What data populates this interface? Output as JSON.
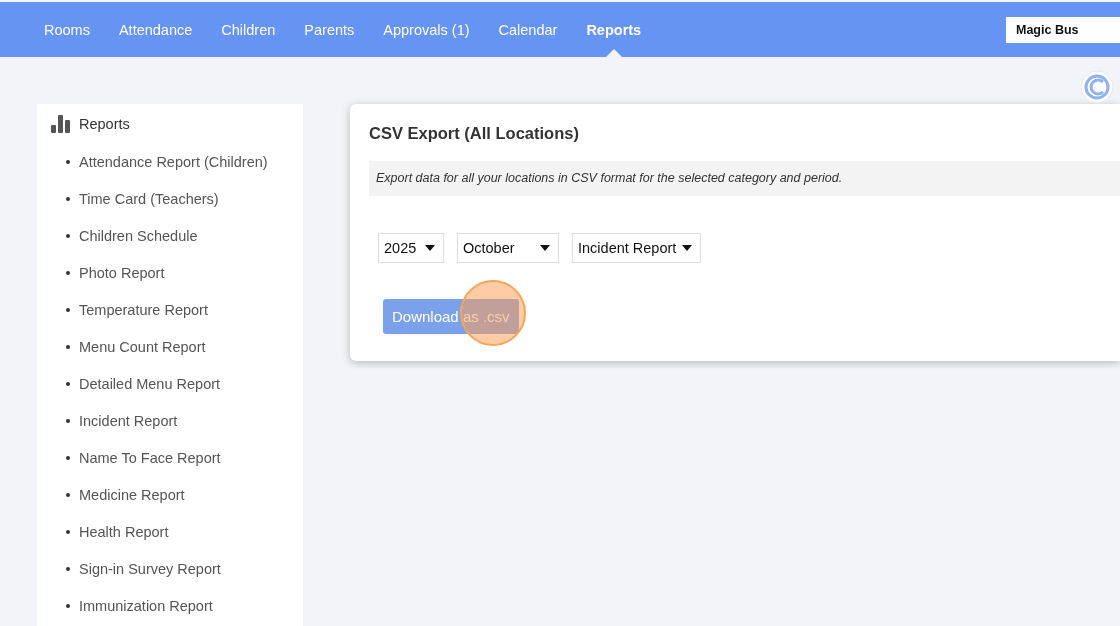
{
  "nav": {
    "items": [
      {
        "label": "Rooms",
        "selected": false
      },
      {
        "label": "Attendance",
        "selected": false
      },
      {
        "label": "Children",
        "selected": false
      },
      {
        "label": "Parents",
        "selected": false
      },
      {
        "label": "Approvals (1)",
        "selected": false
      },
      {
        "label": "Calendar",
        "selected": false
      },
      {
        "label": "Reports",
        "selected": true
      }
    ],
    "school_field": {
      "value": "Magic Bus"
    }
  },
  "sidebar": {
    "title": "Reports",
    "items": [
      "Attendance Report (Children)",
      "Time Card (Teachers)",
      "Children Schedule",
      "Photo Report",
      "Temperature Report",
      "Menu Count Report",
      "Detailed Menu Report",
      "Incident Report",
      "Name To Face Report",
      "Medicine Report",
      "Health Report",
      "Sign-in Survey Report",
      "Immunization Report"
    ]
  },
  "card": {
    "title": "CSV Export (All Locations)",
    "note": "Export data for all your locations in CSV format for the selected category and period.",
    "selects": [
      {
        "value": "2025"
      },
      {
        "value": "October"
      },
      {
        "value": "Incident Report"
      }
    ],
    "button": {
      "label": "Download as .csv",
      "highlighted": true
    }
  }
}
